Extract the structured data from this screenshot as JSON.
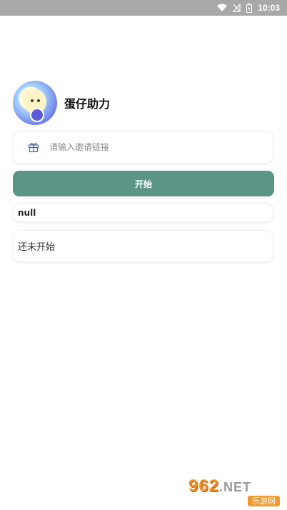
{
  "status_bar": {
    "time": "10:03"
  },
  "app": {
    "title": "蛋仔助力"
  },
  "invite": {
    "value": "",
    "placeholder": "请输入邀请链接"
  },
  "start_button": {
    "label": "开始"
  },
  "output": {
    "value": "null"
  },
  "status": {
    "text": "还未开始"
  },
  "watermark": {
    "number": "962",
    "suffix": ".NET",
    "site": "乐游网"
  },
  "colors": {
    "accent": "#5b9585",
    "status_bar": "#a8a8a8"
  }
}
